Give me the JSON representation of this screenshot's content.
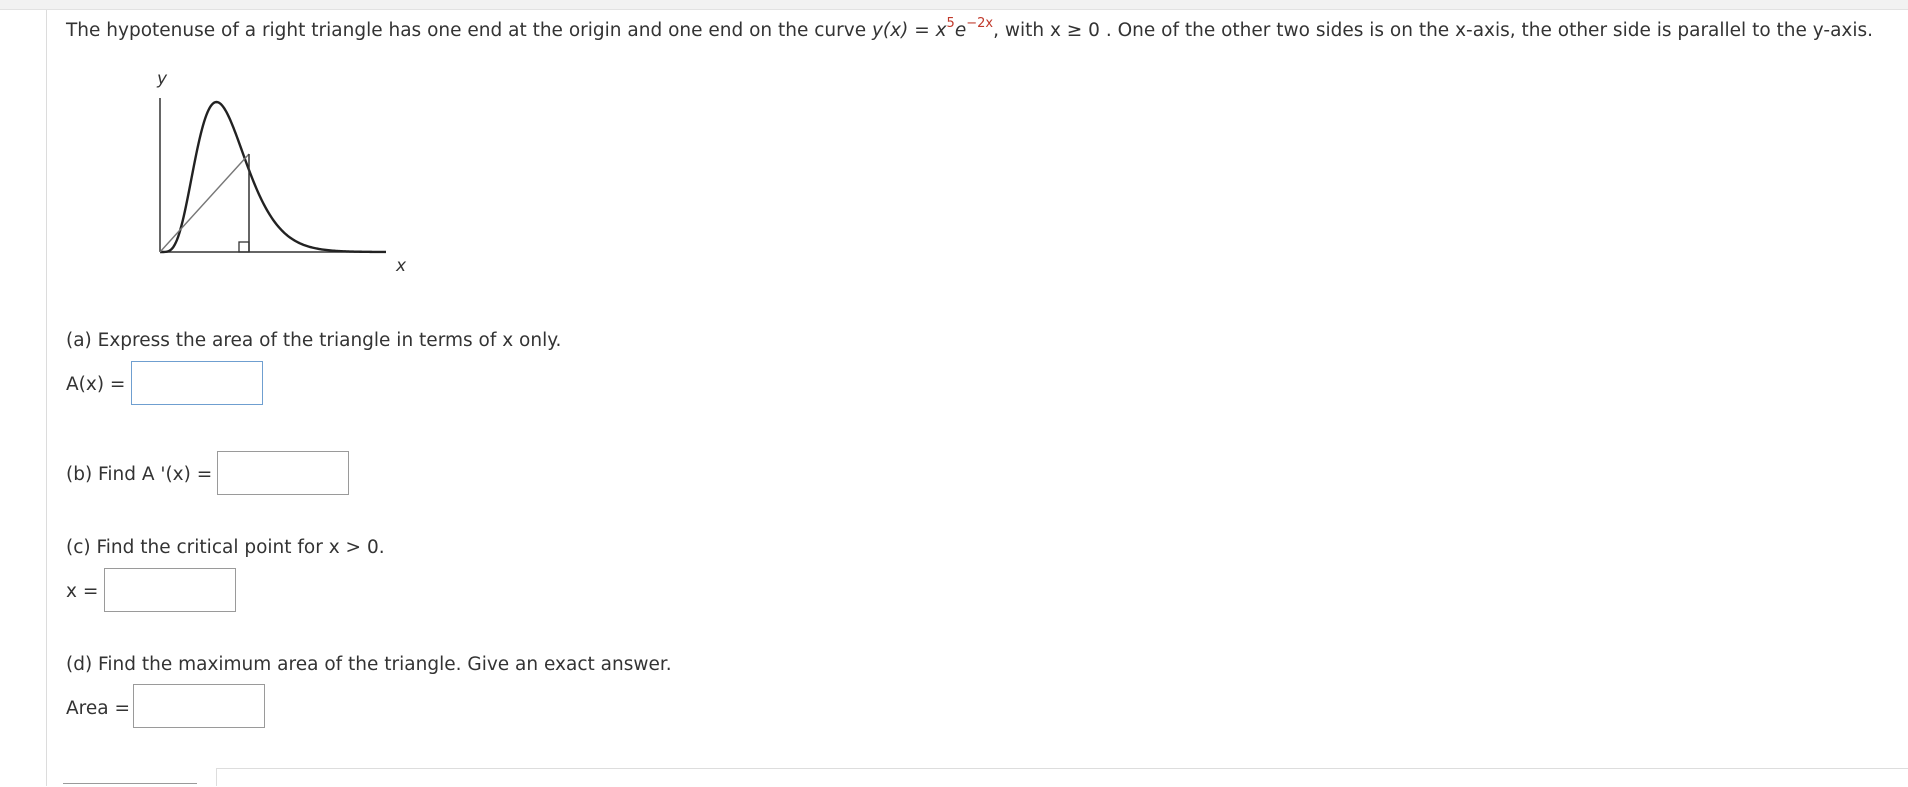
{
  "question": {
    "lead": "The hypotenuse of a right triangle has one end at the origin and one end on the curve ",
    "func": "y(x) = x",
    "exp1": "5",
    "base": "e",
    "exp2": "−2x",
    "cond": ", with x ≥ 0 . One of the other two sides is on the x-axis, the other side is parallel to the y-axis."
  },
  "figure": {
    "y_label": "y",
    "x_label": "x"
  },
  "parts": {
    "a": {
      "text": "(a) Express the area of the triangle in terms of x only.",
      "label": "A(x) ="
    },
    "b": {
      "label": "(b) Find A '(x) ="
    },
    "c": {
      "text": "(c) Find the critical point for x > 0.",
      "label": "x ="
    },
    "d": {
      "text": "(d) Find the maximum area of the triangle. Give an exact answer.",
      "label": "Area ="
    }
  },
  "inputs": {
    "a": "",
    "b": "",
    "c": "",
    "d": ""
  }
}
